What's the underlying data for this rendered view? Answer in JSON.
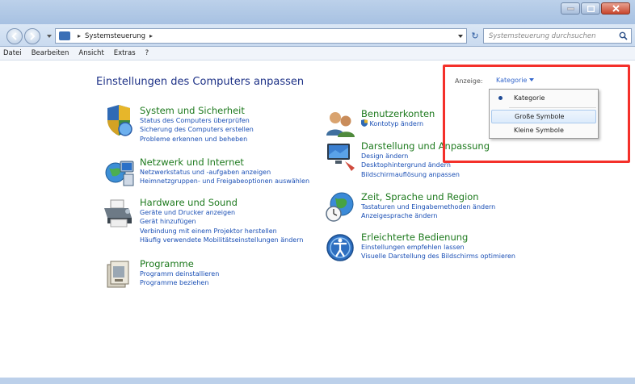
{
  "breadcrumb": {
    "location": "Systemsteuerung"
  },
  "search": {
    "placeholder": "Systemsteuerung durchsuchen"
  },
  "menu": [
    "Datei",
    "Bearbeiten",
    "Ansicht",
    "Extras",
    "?"
  ],
  "heading": "Einstellungen des Computers anpassen",
  "view": {
    "label": "Anzeige:",
    "value": "Kategorie"
  },
  "categories": [
    {
      "title": "System und Sicherheit",
      "icon": "shield-icon",
      "links": [
        "Status des Computers überprüfen",
        "Sicherung des Computers erstellen",
        "Probleme erkennen und beheben"
      ]
    },
    {
      "title": "Netzwerk und Internet",
      "icon": "network-icon",
      "links": [
        "Netzwerkstatus und -aufgaben anzeigen",
        "Heimnetzgruppen- und Freigabeoptionen auswählen"
      ]
    },
    {
      "title": "Hardware und Sound",
      "icon": "printer-icon",
      "links": [
        "Geräte und Drucker anzeigen",
        "Gerät hinzufügen",
        "Verbindung mit einem Projektor herstellen",
        "Häufig verwendete Mobilitätseinstellungen ändern"
      ]
    },
    {
      "title": "Programme",
      "icon": "programs-icon",
      "links": [
        "Programm deinstallieren",
        "Programme beziehen"
      ]
    },
    {
      "title": "Benutzerkonten",
      "icon": "users-icon",
      "links": [
        "Kontotyp ändern"
      ]
    },
    {
      "title": "Darstellung und Anpassung",
      "icon": "display-icon",
      "links": [
        "Design ändern",
        "Desktophintergrund ändern",
        "Bildschirmauflösung anpassen"
      ]
    },
    {
      "title": "Zeit, Sprache und Region",
      "icon": "globe-clock-icon",
      "links": [
        "Tastaturen und Eingabemethoden ändern",
        "Anzeigesprache ändern"
      ]
    },
    {
      "title": "Erleichterte Bedienung",
      "icon": "accessibility-icon",
      "links": [
        "Einstellungen empfehlen lassen",
        "Visuelle Darstellung des Bildschirms optimieren"
      ]
    }
  ],
  "dropdown": {
    "items": [
      "Kategorie",
      "Große Symbole",
      "Kleine Symbole"
    ]
  },
  "colors": {
    "link": "#1a4fb5",
    "category_title": "#1e7a1e",
    "heading": "#1e3287",
    "highlight_box": "#f4302a"
  }
}
